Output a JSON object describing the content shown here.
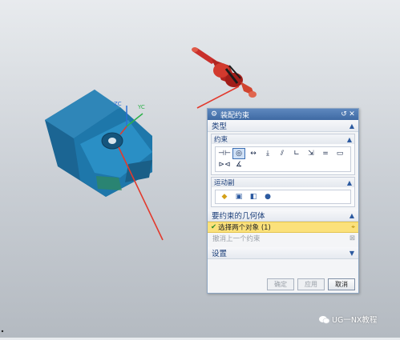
{
  "dialog": {
    "title": "装配约束",
    "type_section": {
      "label": "类型",
      "constraint_group": {
        "label": "约束",
        "icons_row1": [
          "touch-align-icon",
          "concentric-icon",
          "distance-icon",
          "fix-icon",
          "parallel-icon",
          "perpendicular-icon"
        ],
        "icons_row2": [
          "fit-icon",
          "bond-icon",
          "center-icon",
          "angle-icon",
          "align-lock-icon"
        ],
        "equals_glyph": "="
      },
      "motion_group": {
        "label": "运动副",
        "icons": [
          "hinge-icon",
          "slider-icon",
          "cylindrical-icon",
          "ball-joint-icon"
        ]
      }
    },
    "geometry_section": {
      "label": "要约束的几何体",
      "select_row": "选择两个对象 (1)",
      "undo_row": "撤消上一个约束"
    },
    "settings_section": {
      "label": "设置"
    },
    "buttons": {
      "ok": "确定",
      "apply": "应用",
      "cancel": "取消"
    }
  },
  "viewport": {
    "triad": {
      "zc": "ZC",
      "yc": "YC"
    }
  },
  "watermark": "UG一NX教程",
  "colors": {
    "part_body": "#1f6e9e",
    "red_arrow": "#e23a2d",
    "pin": "#c9302c",
    "selection": "#fbe17b"
  }
}
